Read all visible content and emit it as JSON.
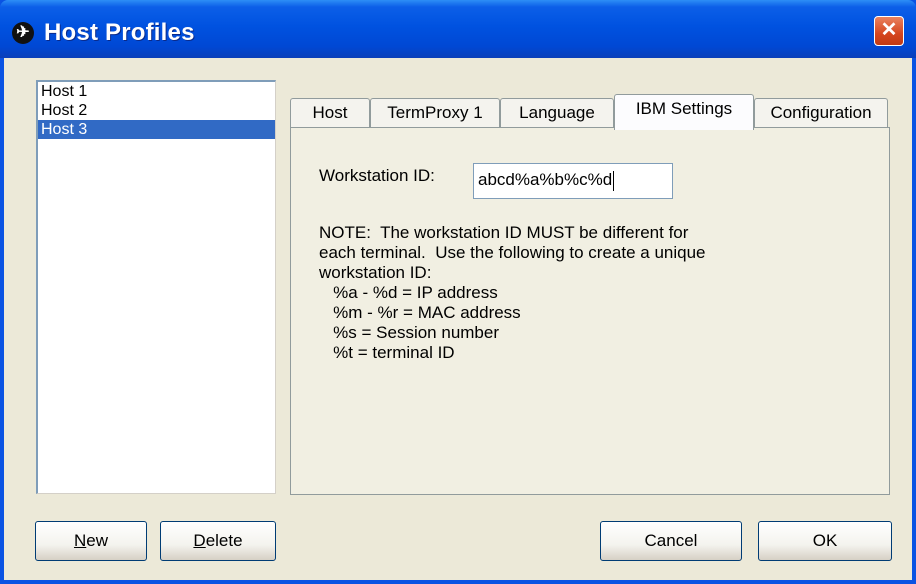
{
  "window": {
    "title": "Host Profiles"
  },
  "hosts": [
    {
      "label": "Host 1",
      "selected": false
    },
    {
      "label": "Host 2",
      "selected": false
    },
    {
      "label": "Host 3",
      "selected": true
    }
  ],
  "tabs": [
    {
      "label": "Host",
      "active": false
    },
    {
      "label": "TermProxy 1",
      "active": false
    },
    {
      "label": "Language",
      "active": false
    },
    {
      "label": "IBM Settings",
      "active": true
    },
    {
      "label": "Configuration",
      "active": false
    }
  ],
  "ibm_settings": {
    "workstation_label": "Workstation ID:",
    "workstation_value": "abcd%a%b%c%d",
    "note_lines": [
      "NOTE:  The workstation ID MUST be different for",
      "each terminal.  Use the following to create a unique",
      "workstation ID:",
      "   %a - %d = IP address",
      "   %m - %r = MAC address",
      "   %s = Session number",
      "   %t = terminal ID"
    ]
  },
  "buttons": {
    "new": {
      "first": "N",
      "rest": "ew"
    },
    "delete": {
      "first": "D",
      "rest": "elete"
    },
    "cancel": "Cancel",
    "ok": "OK"
  },
  "colors": {
    "titlebar": "#0052e0",
    "selection": "#316ac5",
    "dialog_bg": "#ece9d8",
    "close": "#d5461f"
  }
}
